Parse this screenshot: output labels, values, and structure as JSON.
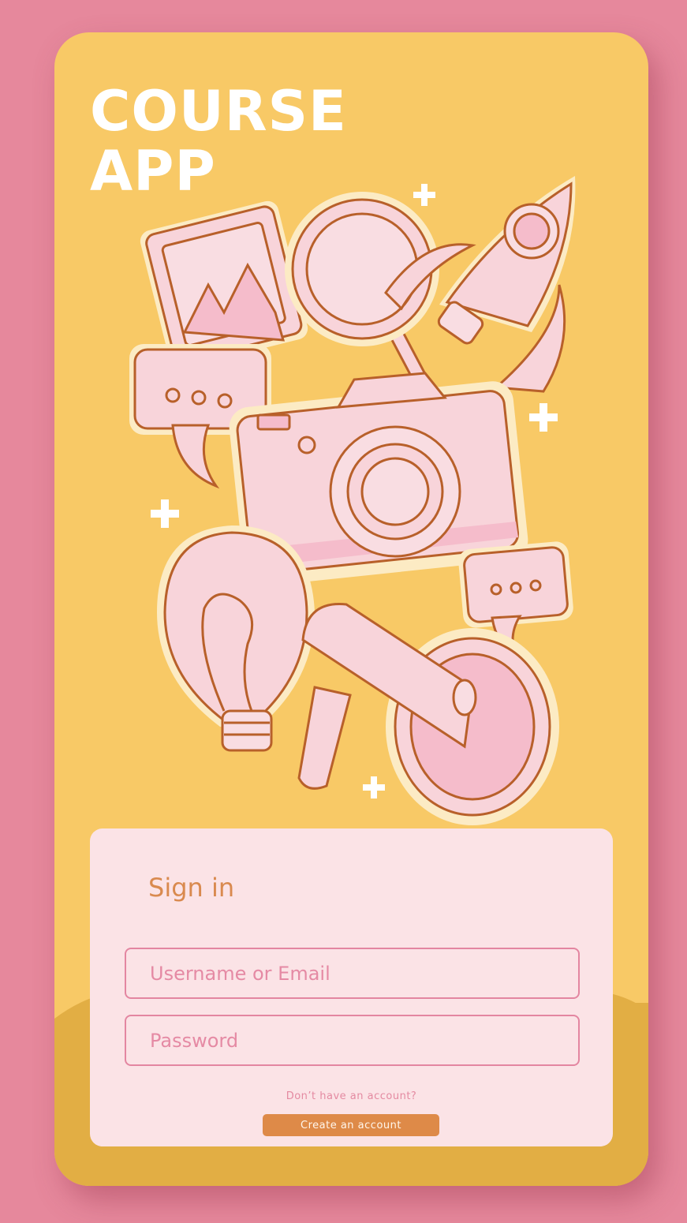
{
  "app": {
    "title_line1": "COURSE",
    "title_line2": "APP"
  },
  "illustration": {
    "items": [
      "picture-frame-icon",
      "magnifier-icon",
      "rocket-icon",
      "chat-bubble-icon",
      "camera-icon",
      "lightbulb-icon",
      "megaphone-icon",
      "sparkle-icon"
    ]
  },
  "signin": {
    "heading": "Sign in",
    "username_placeholder": "Username or Email",
    "password_placeholder": "Password",
    "no_account_prompt": "Don’t have an account?",
    "create_account_label": "Create an account"
  },
  "colors": {
    "background": "#e6889c",
    "panel": "#f8c966",
    "panel_bottom": "#e2ae44",
    "card": "#fbe3e6",
    "field_border": "#e386a1",
    "heading": "#d98a4f",
    "button": "#de8a48"
  }
}
